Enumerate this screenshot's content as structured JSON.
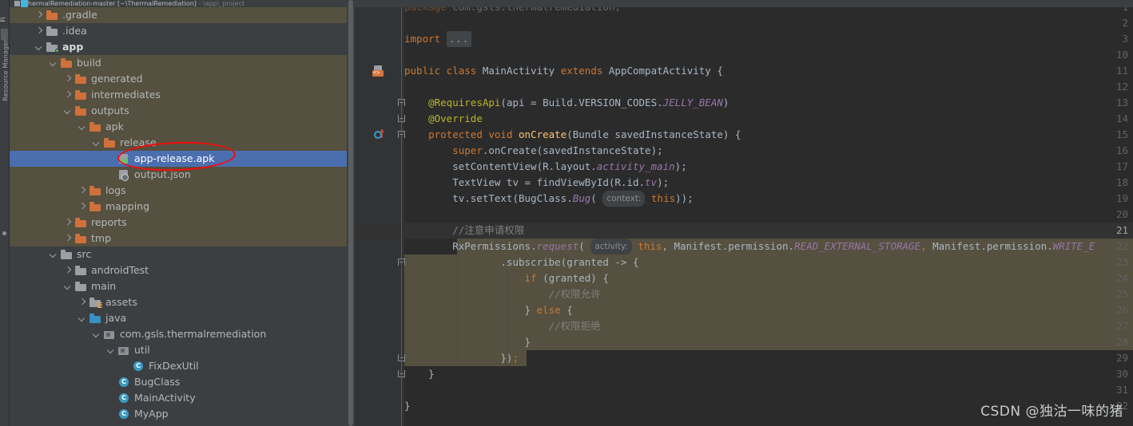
{
  "window": {
    "title_text": "ThermalRemediation-master [~\\ThermalRemediation]",
    "title_suffix": "- \\app\\_project",
    "toolstrip_label": "Resource Manager",
    "toolstrip_label2": "Fi"
  },
  "project_tree": {
    "items": [
      {
        "label": ".gradle",
        "indent": 1,
        "arrow": "right",
        "icon": "folder-orange",
        "style": "normal"
      },
      {
        "label": ".idea",
        "indent": 1,
        "arrow": "right",
        "icon": "folder-grey",
        "style": "normal"
      },
      {
        "label": "app",
        "indent": 1,
        "arrow": "down",
        "icon": "folder-grey-module",
        "style": "bold"
      },
      {
        "label": "build",
        "indent": 2,
        "arrow": "down",
        "icon": "folder-orange",
        "style": "normal"
      },
      {
        "label": "generated",
        "indent": 3,
        "arrow": "right",
        "icon": "folder-orange",
        "style": "normal"
      },
      {
        "label": "intermediates",
        "indent": 3,
        "arrow": "right",
        "icon": "folder-orange",
        "style": "normal"
      },
      {
        "label": "outputs",
        "indent": 3,
        "arrow": "down",
        "icon": "folder-orange",
        "style": "normal"
      },
      {
        "label": "apk",
        "indent": 4,
        "arrow": "down",
        "icon": "folder-orange",
        "style": "normal"
      },
      {
        "label": "release",
        "indent": 5,
        "arrow": "down",
        "icon": "folder-orange",
        "style": "normal"
      },
      {
        "label": "app-release.apk",
        "indent": 6,
        "arrow": "none",
        "icon": "apk",
        "style": "selected"
      },
      {
        "label": "output.json",
        "indent": 6,
        "arrow": "none",
        "icon": "json",
        "style": "normal"
      },
      {
        "label": "logs",
        "indent": 4,
        "arrow": "right",
        "icon": "folder-orange",
        "style": "normal"
      },
      {
        "label": "mapping",
        "indent": 4,
        "arrow": "right",
        "icon": "folder-orange",
        "style": "normal"
      },
      {
        "label": "reports",
        "indent": 3,
        "arrow": "right",
        "icon": "folder-orange",
        "style": "normal"
      },
      {
        "label": "tmp",
        "indent": 3,
        "arrow": "right",
        "icon": "folder-orange",
        "style": "normal"
      },
      {
        "label": "src",
        "indent": 2,
        "arrow": "down",
        "icon": "folder-grey",
        "style": "normal"
      },
      {
        "label": "androidTest",
        "indent": 3,
        "arrow": "right",
        "icon": "folder-grey",
        "style": "normal"
      },
      {
        "label": "main",
        "indent": 3,
        "arrow": "down",
        "icon": "folder-grey",
        "style": "normal"
      },
      {
        "label": "assets",
        "indent": 4,
        "arrow": "right",
        "icon": "folder-assets",
        "style": "normal"
      },
      {
        "label": "java",
        "indent": 4,
        "arrow": "down",
        "icon": "folder-blue",
        "style": "normal"
      },
      {
        "label": "com.gsls.thermalremediation",
        "indent": 5,
        "arrow": "down",
        "icon": "package",
        "style": "normal"
      },
      {
        "label": "util",
        "indent": 6,
        "arrow": "down",
        "icon": "package",
        "style": "normal"
      },
      {
        "label": "FixDexUtil",
        "indent": 7,
        "arrow": "none",
        "icon": "class",
        "style": "normal"
      },
      {
        "label": "BugClass",
        "indent": 6,
        "arrow": "none",
        "icon": "class",
        "style": "normal"
      },
      {
        "label": "MainActivity",
        "indent": 6,
        "arrow": "none",
        "icon": "class",
        "style": "normal"
      },
      {
        "label": "MyApp",
        "indent": 6,
        "arrow": "none",
        "icon": "class",
        "style": "normal"
      }
    ],
    "annotation": {
      "type": "red-ellipse",
      "targets": "app-release.apk"
    },
    "highlight_color": "#4b6eaf",
    "alt_row_color": "#55503f"
  },
  "editor": {
    "current_line": 21,
    "lines": [
      {
        "num": "1",
        "text": "package com.gsls.thermalremediation;",
        "cut": true
      },
      {
        "num": "2",
        "text": ""
      },
      {
        "num": "3",
        "text": "import ..."
      },
      {
        "num": "10",
        "text": ""
      },
      {
        "num": "11",
        "text": "public class MainActivity extends AppCompatActivity {"
      },
      {
        "num": "12",
        "text": ""
      },
      {
        "num": "13",
        "text": "    @RequiresApi(api = Build.VERSION_CODES.JELLY_BEAN)"
      },
      {
        "num": "14",
        "text": "    @Override"
      },
      {
        "num": "15",
        "text": "    protected void onCreate(Bundle savedInstanceState) {"
      },
      {
        "num": "16",
        "text": "        super.onCreate(savedInstanceState);"
      },
      {
        "num": "17",
        "text": "        setContentView(R.layout.activity_main);"
      },
      {
        "num": "18",
        "text": "        TextView tv = findViewById(R.id.tv);"
      },
      {
        "num": "19",
        "text": "        tv.setText(BugClass.Bug( context: this));"
      },
      {
        "num": "20",
        "text": ""
      },
      {
        "num": "21",
        "text": "        //注意申请权限"
      },
      {
        "num": "22",
        "text": "        RxPermissions.request( activity: this, Manifest.permission.READ_EXTERNAL_STORAGE, Manifest.permission.WRITE_E"
      },
      {
        "num": "23",
        "text": "                .subscribe(granted -> {"
      },
      {
        "num": "24",
        "text": "                    if (granted) {"
      },
      {
        "num": "25",
        "text": "                        //权限允许"
      },
      {
        "num": "26",
        "text": "                    } else {"
      },
      {
        "num": "27",
        "text": "                        //权限拒绝"
      },
      {
        "num": "28",
        "text": "                    }"
      },
      {
        "num": "29",
        "text": "                });"
      },
      {
        "num": "30",
        "text": "    }"
      },
      {
        "num": "31",
        "text": ""
      },
      {
        "num": "32",
        "text": "}"
      }
    ],
    "inlay_hints": [
      "context:",
      "activity:"
    ],
    "fold_placeholder": "...",
    "colors": {
      "background": "#2b2b2b",
      "gutter": "#313335",
      "keyword": "#cc7832",
      "string": "#6a8759",
      "comment": "#808080",
      "number": "#6897bb",
      "method": "#ffc66d",
      "field": "#9876aa",
      "annotation": "#bbb529",
      "default_text": "#a9b7c6",
      "selection_block": "#55503f",
      "current_line": "#323232"
    }
  },
  "watermark": {
    "text": "CSDN @独沽一味的猪"
  }
}
